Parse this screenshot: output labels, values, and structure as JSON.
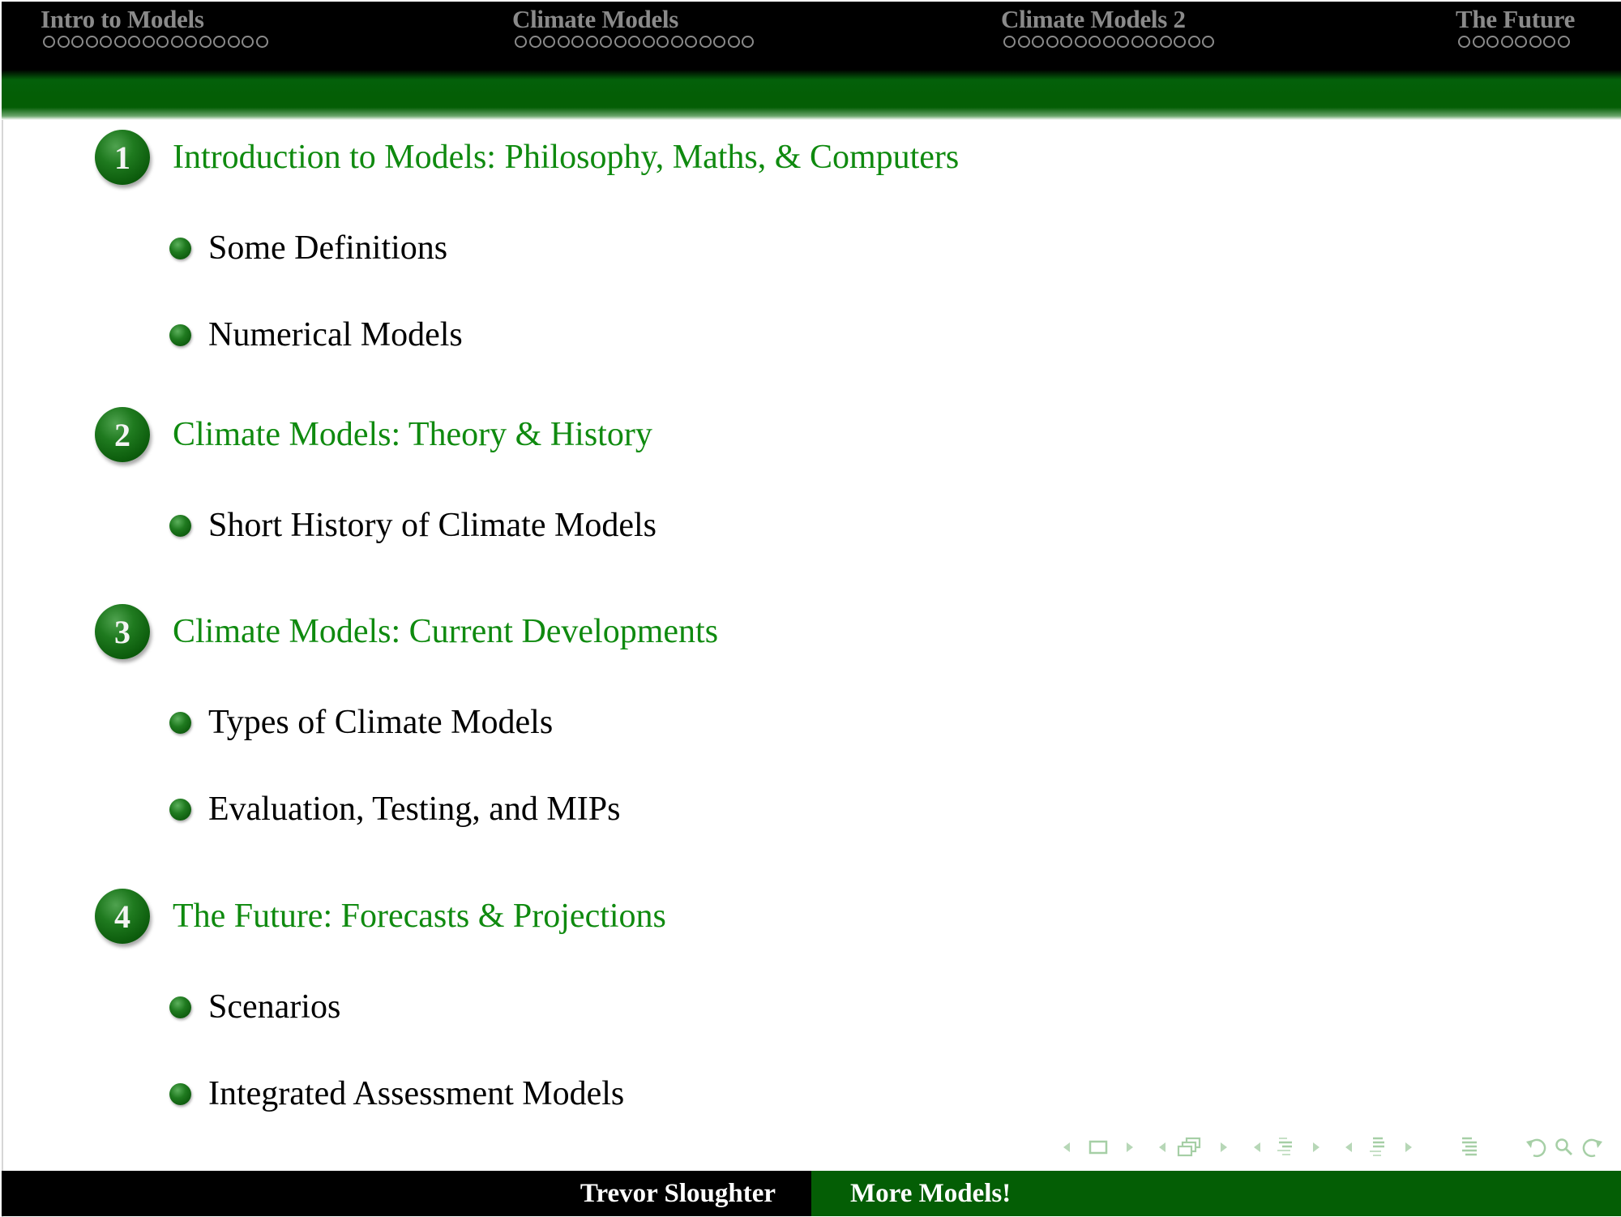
{
  "header": {
    "sections": [
      {
        "label": "Intro to Models",
        "slide_count": 16
      },
      {
        "label": "Climate Models",
        "slide_count": 17
      },
      {
        "label": "Climate Models 2",
        "slide_count": 15
      },
      {
        "label": "The Future",
        "slide_count": 8
      }
    ]
  },
  "toc": {
    "sections": [
      {
        "number": "1",
        "title": "Introduction to Models: Philosophy, Maths, & Computers",
        "subsections": [
          "Some Definitions",
          "Numerical Models"
        ]
      },
      {
        "number": "2",
        "title": "Climate Models: Theory & History",
        "subsections": [
          "Short History of Climate Models"
        ]
      },
      {
        "number": "3",
        "title": "Climate Models: Current Developments",
        "subsections": [
          "Types of Climate Models",
          "Evaluation, Testing, and MIPs"
        ]
      },
      {
        "number": "4",
        "title": "The Future: Forecasts & Projections",
        "subsections": [
          "Scenarios",
          "Integrated Assessment Models"
        ]
      }
    ]
  },
  "nav_symbols": [
    {
      "name": "prev-slide-arrow-icon"
    },
    {
      "name": "slide-icon"
    },
    {
      "name": "next-slide-arrow-icon"
    },
    {
      "name": "prev-frame-arrow-icon"
    },
    {
      "name": "frame-icon"
    },
    {
      "name": "next-frame-arrow-icon"
    },
    {
      "name": "prev-subsection-arrow-icon"
    },
    {
      "name": "subsection-icon"
    },
    {
      "name": "next-subsection-arrow-icon"
    },
    {
      "name": "prev-section-arrow-icon"
    },
    {
      "name": "section-icon"
    },
    {
      "name": "next-section-arrow-icon"
    },
    {
      "name": "document-icon"
    },
    {
      "name": "back-icon"
    },
    {
      "name": "search-icon"
    },
    {
      "name": "forward-icon"
    }
  ],
  "footer": {
    "author": "Trevor Sloughter",
    "title": "More Models!"
  },
  "colors": {
    "theme_green": "#045e05",
    "section_title_green": "#0f8a0f",
    "header_black": "#000000",
    "header_text_gray": "#8a8a8a",
    "nav_symbol_green": "#a8d0a8"
  }
}
